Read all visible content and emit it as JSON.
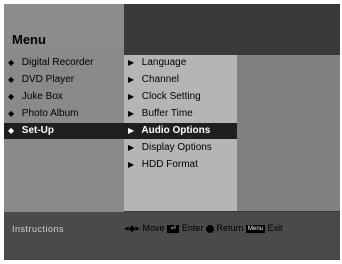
{
  "title": "Menu",
  "main_menu": [
    {
      "label": "Digital Recorder",
      "icon": "diamond-bullet-icon"
    },
    {
      "label": "DVD Player",
      "icon": "diamond-bullet-icon"
    },
    {
      "label": "Juke Box",
      "icon": "diamond-bullet-icon"
    },
    {
      "label": "Photo Album",
      "icon": "diamond-bullet-icon"
    },
    {
      "label": "Set-Up",
      "icon": "diamond-bullet-icon",
      "selected": true
    }
  ],
  "submenu": [
    {
      "label": "Language",
      "icon": "right-arrow-icon"
    },
    {
      "label": "Channel",
      "icon": "right-arrow-icon"
    },
    {
      "label": "Clock Setting",
      "icon": "right-arrow-icon"
    },
    {
      "label": "Buffer Time",
      "icon": "right-arrow-icon"
    },
    {
      "label": "Audio Options",
      "icon": "right-arrow-icon",
      "selected": true
    },
    {
      "label": "Display Options",
      "icon": "right-arrow-icon"
    },
    {
      "label": "HDD Format",
      "icon": "right-arrow-icon"
    }
  ],
  "instructions": {
    "label": "Instructions",
    "move": "Move",
    "enter": "Enter",
    "return": "Return",
    "menu_key": "Menu",
    "exit": "Exit"
  },
  "colors": {
    "highlight": "#1f1f1f",
    "panel_light": "#b5b5b5",
    "panel_dark": "#808080"
  }
}
